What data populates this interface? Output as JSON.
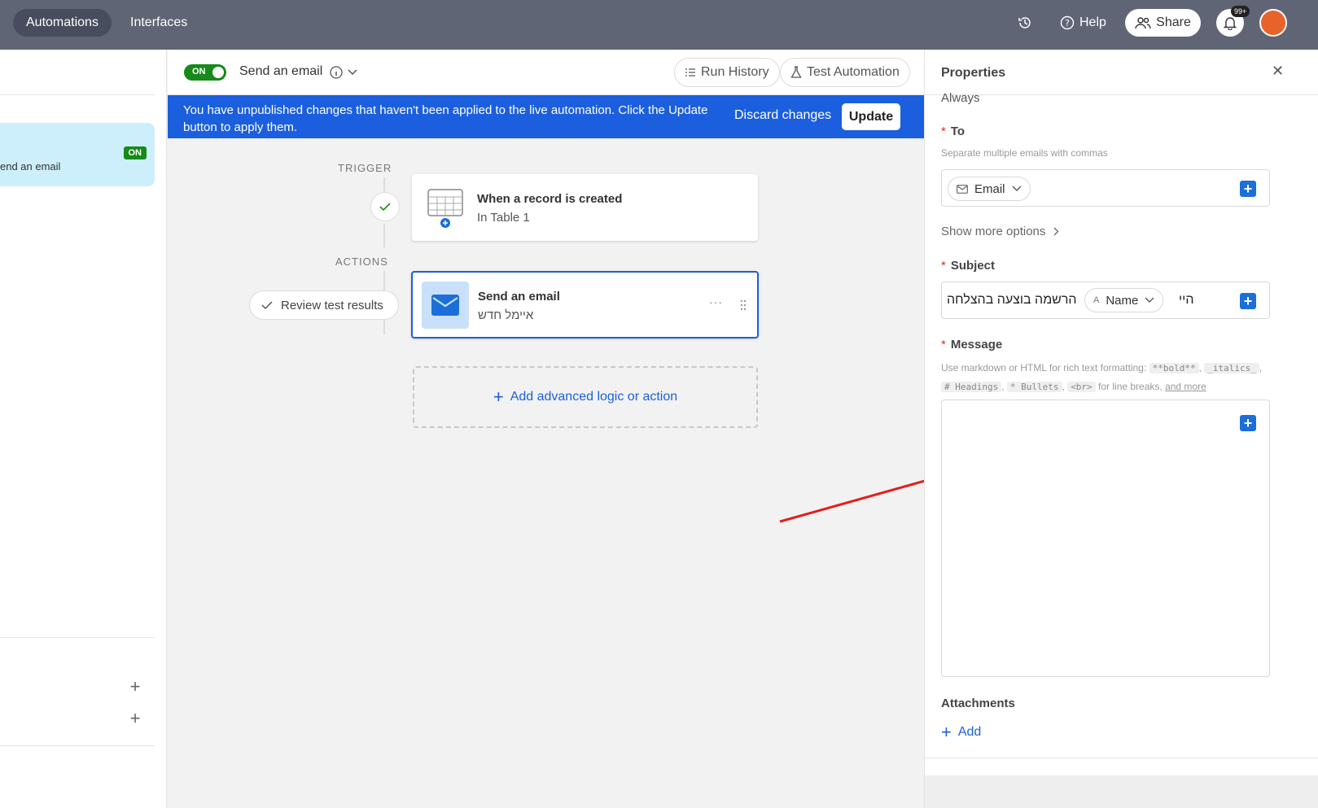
{
  "topbar": {
    "tabs": [
      "Automations",
      "Interfaces"
    ],
    "help_label": "Help",
    "share_label": "Share",
    "notifications_badge": "99+"
  },
  "sidebar": {
    "item_label": "end an email",
    "item_status": "ON"
  },
  "header": {
    "toggle_label": "ON",
    "automation_name": "Send an email",
    "run_history_label": "Run History",
    "test_automation_label": "Test Automation"
  },
  "banner": {
    "message": "You have unpublished changes that haven't been applied to the live automation. Click the Update button to apply them.",
    "discard_label": "Discard changes",
    "update_label": "Update"
  },
  "flow": {
    "trigger_heading": "TRIGGER",
    "actions_heading": "ACTIONS",
    "trigger_title": "When a record is created",
    "trigger_subtitle": "In Table 1",
    "action_title": "Send an email",
    "action_subtitle": "איימל חדש",
    "action_menu": "···",
    "review_label": "Review test results",
    "add_label": "Add advanced logic or action"
  },
  "panel": {
    "title": "Properties",
    "always_text": "Always",
    "to_label": "To",
    "to_hint": "Separate multiple emails with commas",
    "to_chip": "Email",
    "show_more": "Show more options",
    "subject_label": "Subject",
    "subject_text_before": "הרשמה בוצעה בהצלחה",
    "subject_chip": "Name",
    "subject_text_after": "היי",
    "message_label": "Message",
    "message_hint_prefix": "Use markdown or HTML for rich text formatting:",
    "code_bold": "**bold**",
    "code_italics": "_italics_",
    "code_headings": "# Headings",
    "code_bullets": "* Bullets",
    "code_br": "<br>",
    "hint_line_breaks": "for line breaks,",
    "hint_and_more": "and more",
    "attachments_label": "Attachments",
    "add_label": "Add"
  },
  "colors": {
    "topbar": "#5f6575",
    "banner": "#1b5fde",
    "on_green": "#168a1a",
    "sidebar_selected": "#cdeffc",
    "accent_blue": "#1b6fd8",
    "annotation_arrow": "#e0201c"
  }
}
